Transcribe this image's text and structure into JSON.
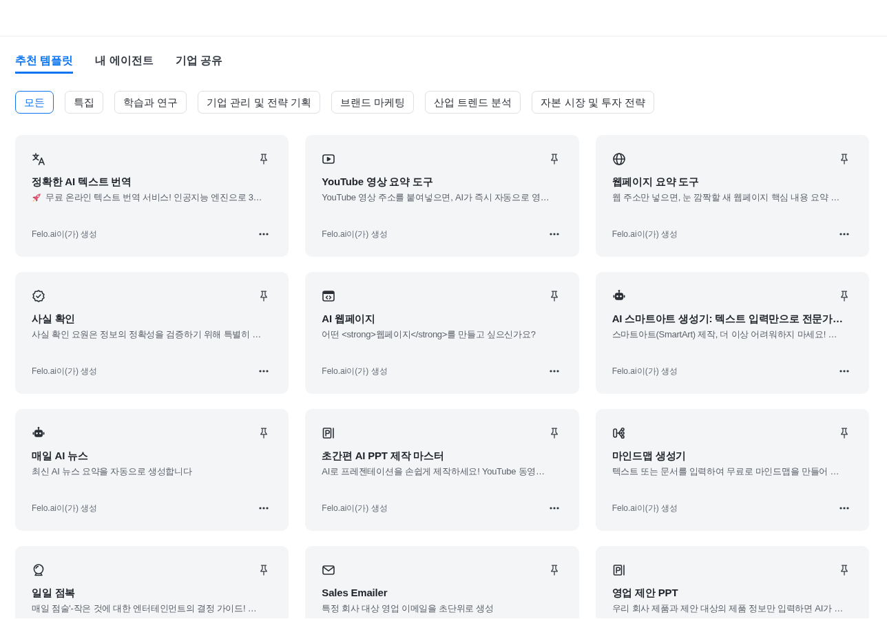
{
  "tabs": [
    {
      "label": "추천 템플릿",
      "selected": true
    },
    {
      "label": "내 에이전트",
      "selected": false
    },
    {
      "label": "기업 공유",
      "selected": false
    }
  ],
  "filters": [
    {
      "label": "모든",
      "selected": true
    },
    {
      "label": "특집",
      "selected": false
    },
    {
      "label": "학습과 연구",
      "selected": false
    },
    {
      "label": "기업 관리 및 전략 기획",
      "selected": false
    },
    {
      "label": "브랜드 마케팅",
      "selected": false
    },
    {
      "label": "산업 트렌드 분석",
      "selected": false
    },
    {
      "label": "자본 시장 및 투자 전략",
      "selected": false
    }
  ],
  "cards": [
    {
      "kind": "translate",
      "title": "정확한 AI 텍스트 번역",
      "lead": {
        "kind": "rocket"
      },
      "description": "무료 온라인 텍스트 번역 서비스! 인공지능 엔진으로 3…",
      "author": "Felo.ai이(가) 생성"
    },
    {
      "kind": "video",
      "title": "YouTube 영상 요약 도구",
      "description": "YouTube 영상 주소를 붙여넣으면, AI가 즉시 자동으로 영…",
      "author": "Felo.ai이(가) 생성"
    },
    {
      "kind": "globe",
      "title": "웹페이지 요약 도구",
      "description": "웹 주소만 넣으면, 눈 깜짝할 새 웹페이지 핵심 내용 요약 …",
      "author": "Felo.ai이(가) 생성"
    },
    {
      "kind": "verified",
      "title": "사실 확인",
      "description": "사실 확인 요원은 정보의 정확성을 검증하기 위해 특별히 …",
      "author": "Felo.ai이(가) 생성"
    },
    {
      "kind": "code",
      "title": "AI 웹페이지",
      "description": "어떤 <strong>웹페이지</strong>를 만들고 싶으신가요?",
      "author": "Felo.ai이(가) 생성"
    },
    {
      "kind": "robot",
      "title": "AI 스마트아트 생성기: 텍스트 입력만으로 전문가…",
      "description": "스마트아트(SmartArt) 제작, 더 이상 어려워하지 마세요! …",
      "author": "Felo.ai이(가) 생성"
    },
    {
      "kind": "robot",
      "title": "매일 AI 뉴스",
      "description": "최신 AI 뉴스 요약을 자동으로 생성합니다",
      "author": "Felo.ai이(가) 생성"
    },
    {
      "kind": "slides",
      "title": "초간편 AI PPT 제작 마스터",
      "description": "AI로 프레젠테이션을 손쉽게 제작하세요! YouTube 동영…",
      "author": "Felo.ai이(가) 생성"
    },
    {
      "kind": "mindmap",
      "title": "마인드맵 생성기",
      "description": "텍스트 또는 문서를 입력하여 무료로 마인드맵을 만들어 …",
      "author": "Felo.ai이(가) 생성"
    },
    {
      "kind": "ball",
      "title": "일일 점복",
      "description": "매일 점술'-작은 것에 대한 엔터테인먼트의 결정 가이드! …"
    },
    {
      "kind": "mail",
      "title": "Sales Emailer",
      "description": "특정 회사 대상 영업 이메일을 초단위로 생성"
    },
    {
      "kind": "slides",
      "title": "영업 제안 PPT",
      "description": "우리 회사 제품과 제안 대상의 제품 정보만 입력하면 AI가 …"
    }
  ]
}
